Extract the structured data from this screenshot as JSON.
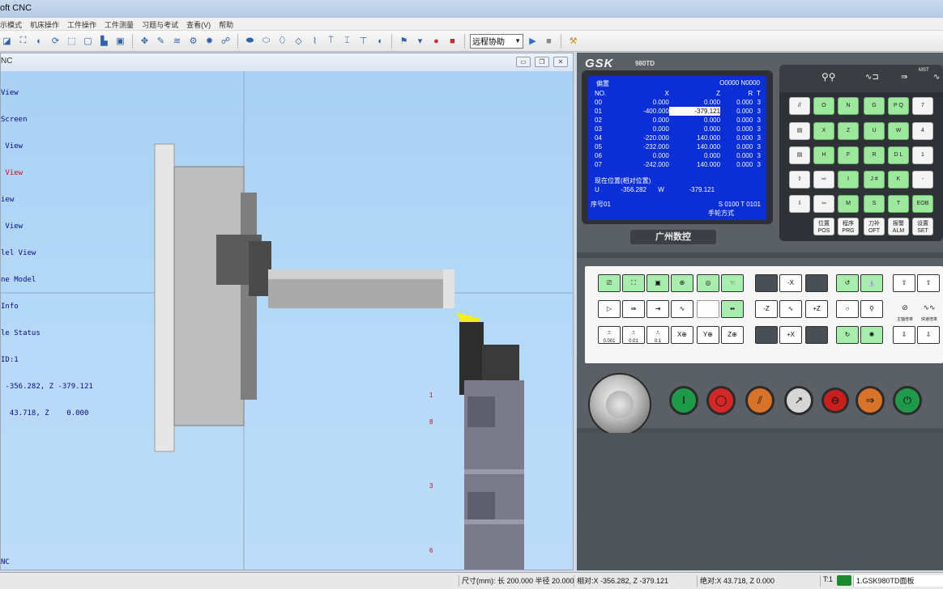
{
  "window": {
    "title": "oft CNC"
  },
  "menu": [
    "示模式",
    "机床操作",
    "工件操作",
    "工件测量",
    "习题与考试",
    "查看(V)",
    "帮助"
  ],
  "toolbar": {
    "mode_select": "远程协助"
  },
  "view": {
    "overlay_lines": [
      "View",
      "Screen",
      " View",
      " View",
      "iew",
      " View",
      "lel View",
      "ne Model",
      "Info",
      "le Status",
      "ID:1",
      " -356.282, Z -379.121",
      "  43.718, Z    0.000"
    ],
    "highlight_index": 3,
    "bottom_label": "NC",
    "tool_labels": [
      "1",
      "8",
      "3",
      "6"
    ]
  },
  "gsk": {
    "logo": "GSK",
    "model": "980TD",
    "screen": {
      "title": "偏置",
      "program_no": "O0000  N0000",
      "headers": [
        "NO.",
        "X",
        "Z",
        "R",
        "T"
      ],
      "rows": [
        [
          "00",
          "0.000",
          "0.000",
          "0.000",
          "3"
        ],
        [
          "01",
          "-400.000",
          "-379.121",
          "0.000",
          "3"
        ],
        [
          "02",
          "0.000",
          "0.000",
          "0.000",
          "3"
        ],
        [
          "03",
          "0.000",
          "0.000",
          "0.000",
          "3"
        ],
        [
          "04",
          "-220.000",
          "140.000",
          "0.000",
          "3"
        ],
        [
          "05",
          "-232.000",
          "140.000",
          "0.000",
          "3"
        ],
        [
          "06",
          "0.000",
          "0.000",
          "0.000",
          "3"
        ],
        [
          "07",
          "-242.000",
          "140.000",
          "0.000",
          "3"
        ]
      ],
      "current_pos_label": "现在位置(相对位置)",
      "current_u_label": "U",
      "current_u": "-356.282",
      "current_w_label": "W",
      "current_w": "-379.121",
      "seq_label": "序号01",
      "spindle_tool": "S  0100   T 0101",
      "mode": "手轮方式"
    },
    "brand": "广州数控",
    "keys": {
      "row1": [
        "O",
        "N",
        "G",
        "P Q",
        "7"
      ],
      "row2": [
        "X",
        "Z",
        "U",
        "W",
        "4"
      ],
      "row3": [
        "H",
        "F",
        "R",
        "D L",
        "1"
      ],
      "row4": [
        "I",
        "J #",
        "K",
        "-"
      ],
      "row5": [
        "M",
        "S",
        "T",
        "EOB"
      ],
      "func": [
        [
          "位置",
          "POS"
        ],
        [
          "程序",
          "PRG"
        ],
        [
          "刀补",
          "OFT"
        ],
        [
          "报警",
          "ALM"
        ],
        [
          "设置",
          "SET"
        ]
      ]
    },
    "op_labels": {
      "minus_x": "-X",
      "minus_z": "-Z",
      "plus_z": "+Z",
      "plus_x": "+X",
      "step_001": "0.001",
      "step_01": "0.01",
      "step_1": "0.1",
      "x_axis": "X⊕",
      "y_axis": "Y⊕",
      "z_axis": "Z⊕",
      "mst": "MST",
      "spindle_rate": "主轴倍率",
      "rapid_rate": "快速倍率"
    }
  },
  "status": {
    "size": "尺寸(mm): 长 200.000 半径  20.000",
    "relative": "相对:X -356.282, Z -379.121",
    "absolute": "绝对:X  43.718, Z    0.000",
    "tool": "T:1",
    "panel": "1.GSK980TD面板"
  },
  "colors": {
    "viewport": "#b4d8f6",
    "screen": "#0b2fd7",
    "key_green": "#9ee89e"
  }
}
